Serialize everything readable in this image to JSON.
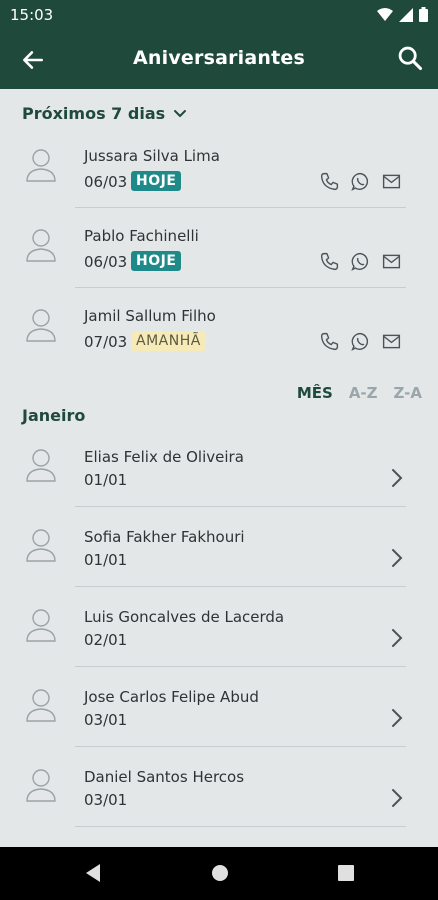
{
  "status": {
    "time": "15:03"
  },
  "appbar": {
    "title": "Aniversariantes",
    "back_icon": "arrow-left-icon",
    "search_icon": "search-icon"
  },
  "upcoming": {
    "header": "Próximos 7 dias",
    "people": [
      {
        "name": "Jussara Silva Lima",
        "date": "06/03",
        "badge": "HOJE",
        "badge_type": "today"
      },
      {
        "name": "Pablo Fachinelli",
        "date": "06/03",
        "badge": "HOJE",
        "badge_type": "today"
      },
      {
        "name": "Jamil Sallum Filho",
        "date": "07/03",
        "badge": "AMANHÃ",
        "badge_type": "tomorrow"
      }
    ]
  },
  "sort": {
    "options": [
      "MÊS",
      "A-Z",
      "Z-A"
    ],
    "selected": "MÊS"
  },
  "month": {
    "label": "Janeiro",
    "people": [
      {
        "name": "Elias Felix de Oliveira",
        "date": "01/01"
      },
      {
        "name": "Sofia Fakher Fakhouri",
        "date": "01/01"
      },
      {
        "name": "Luis Goncalves de Lacerda",
        "date": "02/01"
      },
      {
        "name": "Jose Carlos Felipe Abud",
        "date": "03/01"
      },
      {
        "name": "Daniel Santos Hercos",
        "date": "03/01"
      }
    ]
  },
  "colors": {
    "primary": "#1f4a3b",
    "today_badge": "#1e8a8a",
    "tomorrow_badge": "#f6eab8",
    "background": "#e4e7e8"
  }
}
